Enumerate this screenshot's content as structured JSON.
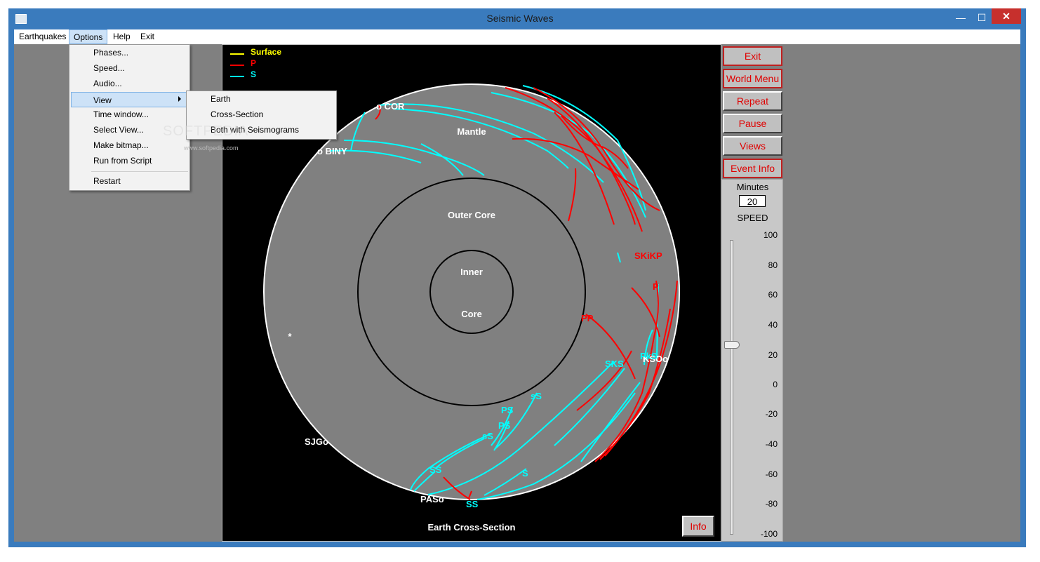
{
  "window": {
    "title": "Seismic Waves"
  },
  "menubar": {
    "earthquakes": "Earthquakes",
    "options": "Options",
    "help": "Help",
    "exit": "Exit"
  },
  "options_menu": {
    "phases": "Phases...",
    "speed": "Speed...",
    "audio": "Audio...",
    "view": "View",
    "time_window": "Time window...",
    "select_view": "Select View...",
    "make_bitmap": "Make bitmap...",
    "run_script": "Run from Script",
    "restart": "Restart"
  },
  "view_submenu": {
    "earth": "Earth",
    "cross_section": "Cross-Section",
    "both": "Both with Seismograms"
  },
  "watermark": {
    "text": "SOFTPEDIA",
    "url": "www.softpedia.com"
  },
  "legend": {
    "surface": "Surface",
    "p": "P",
    "s": "S"
  },
  "colors": {
    "surface": "#ffff00",
    "p": "#ff0000",
    "s": "#00ffff"
  },
  "diagram": {
    "mantle": "Mantle",
    "outer_core": "Outer Core",
    "inner": "Inner",
    "core": "Core",
    "caption": "Earth Cross-Section",
    "epicenter": "*"
  },
  "stations": {
    "cor": "o COR",
    "biny": "o BINY",
    "sjg": "SJGo",
    "pas": "PASo",
    "kso": "KSOo"
  },
  "phase_labels": {
    "skikp": "SKiKP",
    "p": "P",
    "pp": "PP",
    "sks": "SKS",
    "ps1": "PS",
    "ps2": "PS",
    "ss_small1": "sS",
    "ss_small2": "sS",
    "ss1": "SS",
    "ss2": "SS",
    "s": "S",
    "pks": "PkS"
  },
  "sidebar": {
    "exit": "Exit",
    "world_menu": "World Menu",
    "repeat": "Repeat",
    "pause": "Pause",
    "views": "Views",
    "event_info": "Event Info",
    "minutes_label": "Minutes",
    "minutes_value": "20",
    "speed_label": "SPEED",
    "speed_ticks": [
      "100",
      "80",
      "60",
      "40",
      "20",
      "0",
      "-20",
      "-40",
      "-60",
      "-80",
      "-100"
    ],
    "speed_value": 20
  },
  "info_button": "Info"
}
